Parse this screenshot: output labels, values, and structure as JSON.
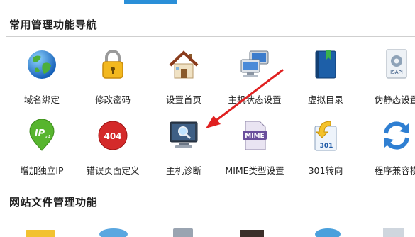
{
  "sections": [
    {
      "title": "常用管理功能导航"
    },
    {
      "title": "网站文件管理功能"
    }
  ],
  "row1": [
    {
      "label": "域名绑定",
      "icon": "globe-icon"
    },
    {
      "label": "修改密码",
      "icon": "padlock-icon"
    },
    {
      "label": "设置首页",
      "icon": "house-icon"
    },
    {
      "label": "主机状态设置",
      "icon": "network-computers-icon"
    },
    {
      "label": "虚拟目录",
      "icon": "book-bookmark-icon"
    },
    {
      "label": "伪静态设置",
      "icon": "isapi-icon"
    }
  ],
  "row2": [
    {
      "label": "增加独立IP",
      "icon": "ipv4-pin-icon"
    },
    {
      "label": "错误页面定义",
      "icon": "error-404-icon"
    },
    {
      "label": "主机诊断",
      "icon": "monitor-magnifier-icon"
    },
    {
      "label": "MIME类型设置",
      "icon": "mime-icon"
    },
    {
      "label": "301转向",
      "icon": "redirect-301-icon"
    },
    {
      "label": "程序兼容模",
      "icon": "refresh-arrows-icon"
    }
  ],
  "icon_text": {
    "isapi": "ISAPI",
    "ipv4": "IP",
    "ipv4_sub": "v4",
    "err404": "404",
    "mime": "MIME",
    "r301": "301"
  },
  "colors": {
    "accent": "#2a8fd8",
    "arrow": "#e02020"
  }
}
